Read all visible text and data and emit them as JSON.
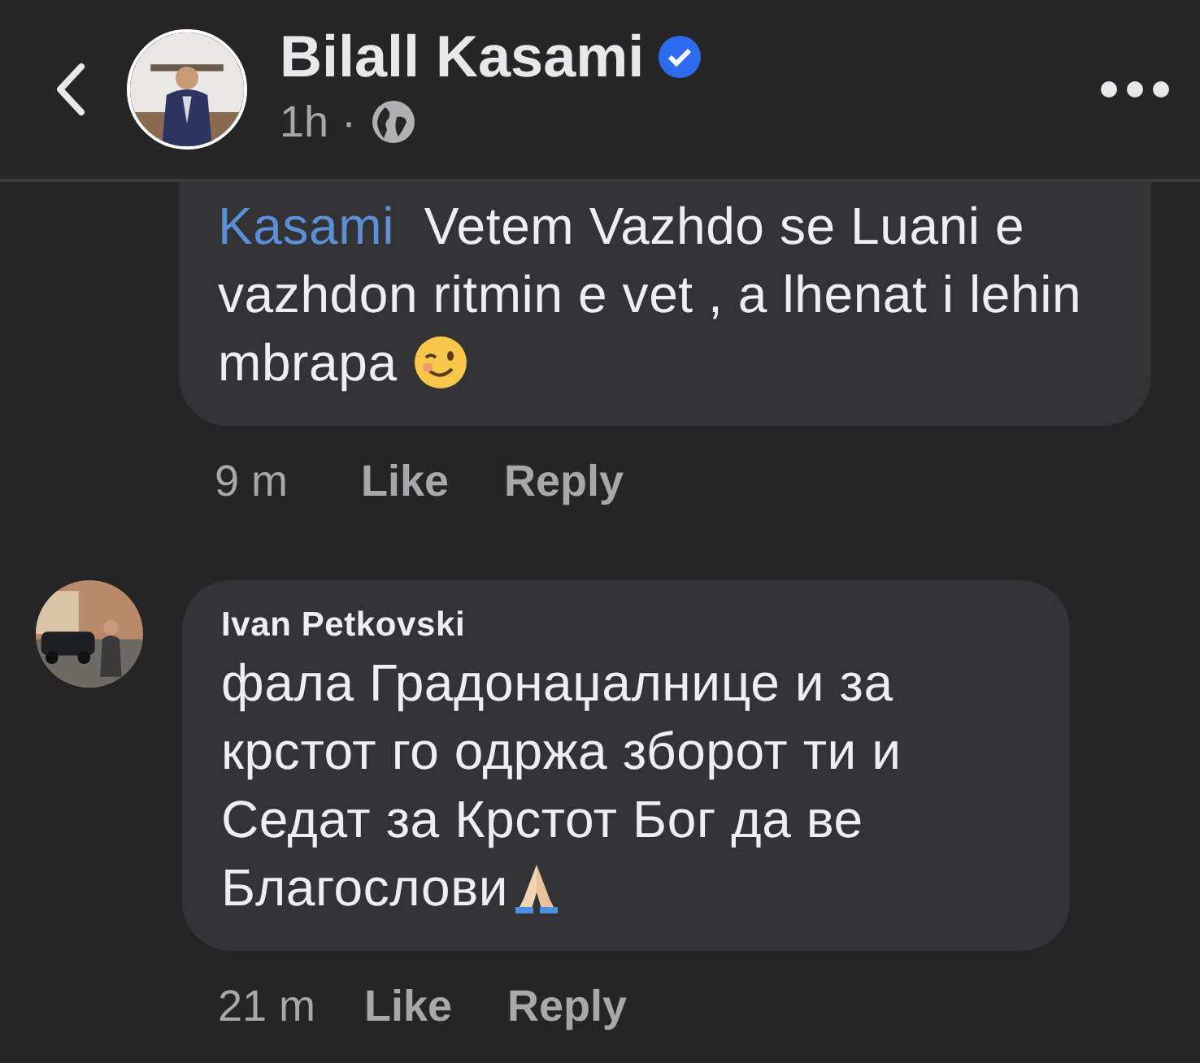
{
  "header": {
    "author": "Bilall Kasami",
    "verified": true,
    "time": "1h",
    "separator": "·"
  },
  "comments": [
    {
      "mention": "Kasami",
      "text": "Vetem Vazhdo se Luani e vazhdon ritmin e vet , a lhenat i lehin mbrapa",
      "kind": "wink",
      "clipped": true,
      "time": "9 m",
      "like": "Like",
      "reply": "Reply"
    },
    {
      "author": "Ivan Petkovski",
      "text": "фала Градонаџалнице и за крстот го одржа зборот ти и Седат за Крстот Бог да ве Благослови",
      "kind": "pray",
      "clipped": false,
      "time": "21 m",
      "like": "Like",
      "reply": "Reply"
    }
  ]
}
